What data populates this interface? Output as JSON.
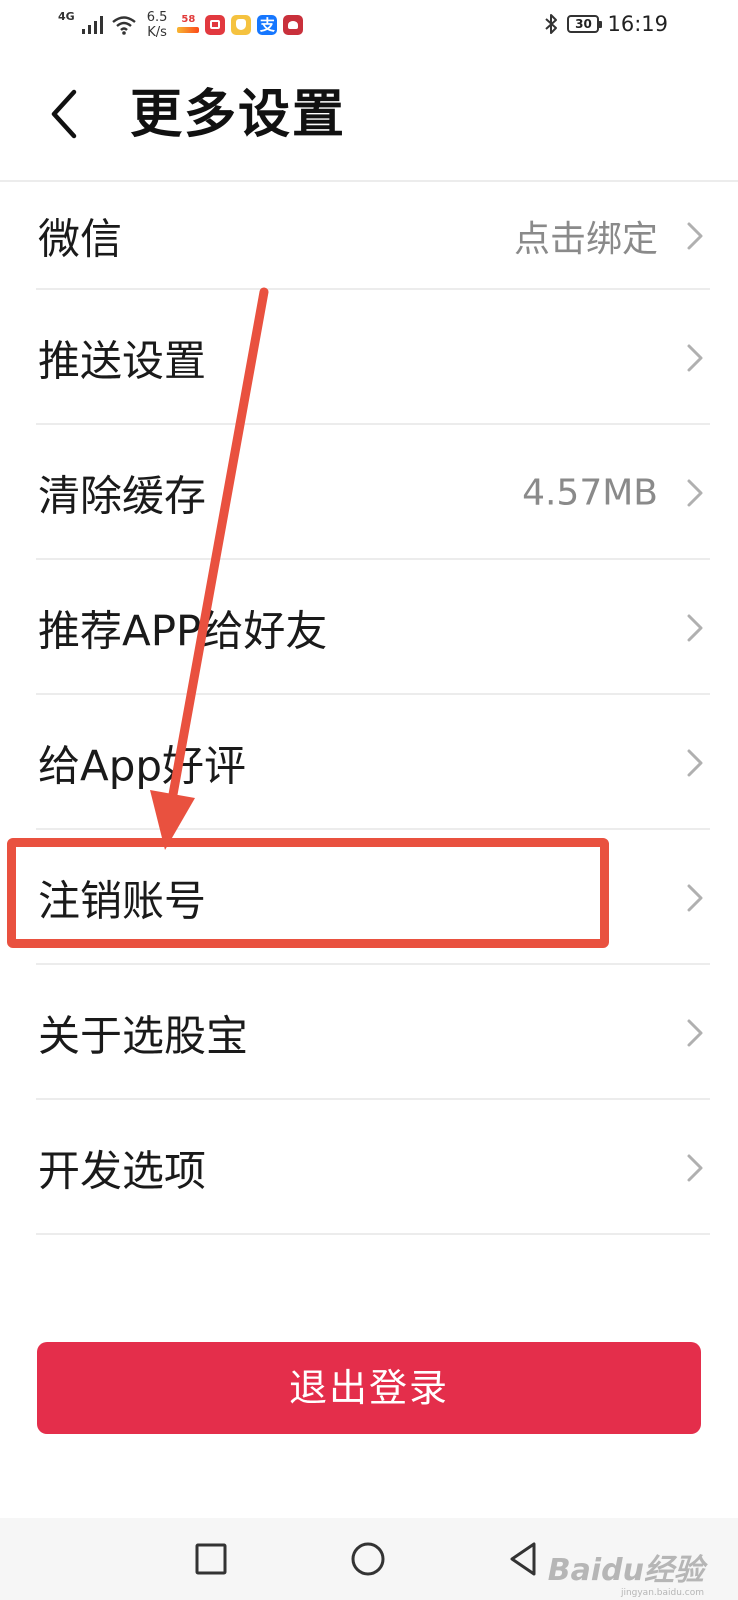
{
  "status_bar": {
    "network": "4G",
    "speed_value": "6.5",
    "speed_unit": "K/s",
    "app_58_label": "58",
    "app_blue_glyph": "支",
    "battery_level": "30",
    "time": "16:19",
    "icons": [
      "signal-icon",
      "wifi-icon",
      "app-58-icon",
      "app-red-icon",
      "app-yellow-icon",
      "alipay-icon",
      "app-maroon-icon",
      "bluetooth-icon",
      "battery-icon"
    ]
  },
  "header": {
    "back_icon": "chevron-left-icon",
    "title": "更多设置"
  },
  "settings": {
    "rows": [
      {
        "label": "微信",
        "value": "点击绑定"
      },
      {
        "label": "推送设置",
        "value": ""
      },
      {
        "label": "清除缓存",
        "value": "4.57MB"
      },
      {
        "label": "推荐APP给好友",
        "value": ""
      },
      {
        "label": "给App好评",
        "value": ""
      },
      {
        "label": "注销账号",
        "value": ""
      },
      {
        "label": "关于选股宝",
        "value": ""
      },
      {
        "label": "开发选项",
        "value": ""
      }
    ],
    "chevron_icon": "chevron-right-icon"
  },
  "annotation": {
    "highlighted_row": "注销账号",
    "color": "#e9513f"
  },
  "logout": {
    "label": "退出登录",
    "color": "#e42e4b"
  },
  "nav_bar": {
    "icons": [
      "recent-apps-icon",
      "home-icon",
      "back-icon"
    ]
  },
  "watermark": {
    "brand": "Baidu经验",
    "url": "jingyan.baidu.com"
  }
}
